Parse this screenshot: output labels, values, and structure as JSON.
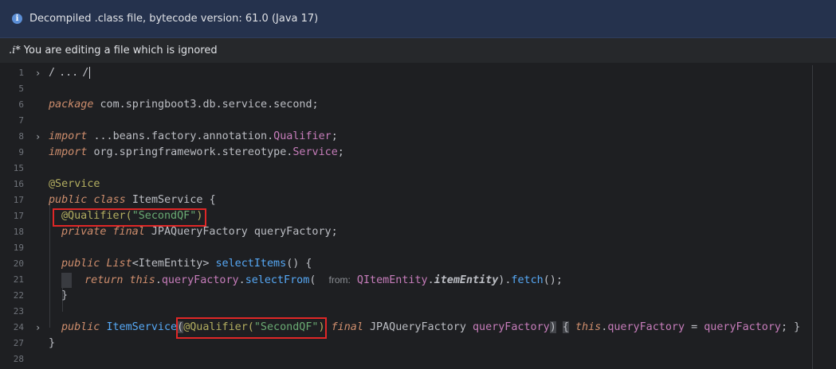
{
  "banners": {
    "decompiled_icon": "info-icon",
    "decompiled_text": "Decompiled .class file, bytecode version: 61.0 (Java 17)",
    "ignored_icon_text": ".i*",
    "ignored_text": "You are editing a file which is ignored"
  },
  "editor": {
    "line_numbers": [
      "1",
      "5",
      "6",
      "7",
      "8",
      "9",
      "15",
      "16",
      "17",
      "18",
      "19",
      "20",
      "21",
      "22",
      "23",
      "24",
      "27",
      "28"
    ],
    "line1": {
      "start": "/",
      "dots": "...",
      "end": "/"
    },
    "line6": {
      "kw": "package",
      "rest": "com.springboot3.db.service.second;"
    },
    "line8": {
      "kw": "import",
      "dots": "...",
      "rest": "beans.factory.annotation.",
      "cls": "Qualifier",
      "semi": ";"
    },
    "line9": {
      "kw": "import",
      "rest": "org.springframework.stereotype.",
      "cls": "Service",
      "semi": ";"
    },
    "line15": {
      "ann": "@Service"
    },
    "line16": {
      "kw1": "public",
      "kw2": "class",
      "name": "ItemService",
      "brace": "{"
    },
    "line17": {
      "ann": "@Qualifier(",
      "str": "\"SecondQF\"",
      "close": ")"
    },
    "line18": {
      "kw1": "private",
      "kw2": "final",
      "type": "JPAQueryFactory",
      "name": "queryFactory",
      "semi": ";"
    },
    "line20": {
      "kw": "public",
      "type": "List",
      "generic": "ItemEntity",
      "fn": "selectItems",
      "rest": "() {"
    },
    "line21": {
      "kw1": "return",
      "kw2": "this",
      "field": "queryFactory",
      "fn": "selectFrom",
      "hint": "from:",
      "cls": "QItemEntity",
      "static": "itemEntity",
      "fn2": "fetch",
      "end": "();"
    },
    "line22": {
      "brace": "}"
    },
    "line24": {
      "kw": "public",
      "name": "ItemService",
      "ann": "@Qualifier(",
      "str": "\"SecondQF\"",
      "close": ")",
      "kw2": "final",
      "type": "JPAQueryFactory",
      "param": "queryFactory",
      "kw3": "this",
      "field": "queryFactory",
      "param2": "queryFactory"
    },
    "line27": {
      "brace": "}"
    }
  }
}
